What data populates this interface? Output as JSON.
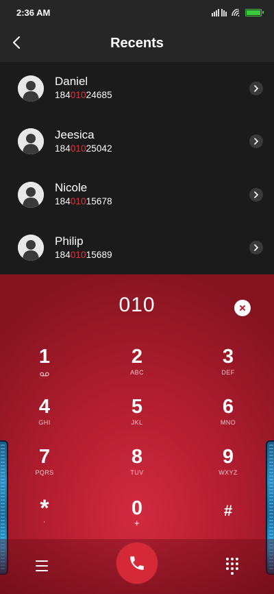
{
  "status": {
    "time": "2:36 AM"
  },
  "header": {
    "title": "Recents"
  },
  "recents": [
    {
      "name": "Daniel",
      "number_prefix": "184",
      "number_match": "010",
      "number_suffix": "24685"
    },
    {
      "name": "Jeesica",
      "number_prefix": "184",
      "number_match": "010",
      "number_suffix": "25042"
    },
    {
      "name": "Nicole",
      "number_prefix": "184",
      "number_match": "010",
      "number_suffix": "15678"
    },
    {
      "name": "Philip",
      "number_prefix": "184",
      "number_match": "010",
      "number_suffix": "15689"
    }
  ],
  "dialer": {
    "display": "010",
    "keys": [
      {
        "digit": "1",
        "letters": ""
      },
      {
        "digit": "2",
        "letters": "ABC"
      },
      {
        "digit": "3",
        "letters": "DEF"
      },
      {
        "digit": "4",
        "letters": "GHI"
      },
      {
        "digit": "5",
        "letters": "JKL"
      },
      {
        "digit": "6",
        "letters": "MNO"
      },
      {
        "digit": "7",
        "letters": "PQRS"
      },
      {
        "digit": "8",
        "letters": "TUV"
      },
      {
        "digit": "9",
        "letters": "WXYZ"
      },
      {
        "digit": "*",
        "letters": ","
      },
      {
        "digit": "0",
        "letters": "+"
      },
      {
        "digit": "#",
        "letters": ""
      }
    ]
  },
  "colors": {
    "accent_red": "#d62938",
    "match_highlight": "#e0343f",
    "battery_green": "#3cc83c"
  },
  "icons": {
    "back": "chevron-left-icon",
    "voicemail": "voicemail-icon",
    "clear": "close-circle-icon",
    "menu": "hamburger-icon",
    "call": "phone-icon",
    "dialpad": "dialpad-icon"
  }
}
